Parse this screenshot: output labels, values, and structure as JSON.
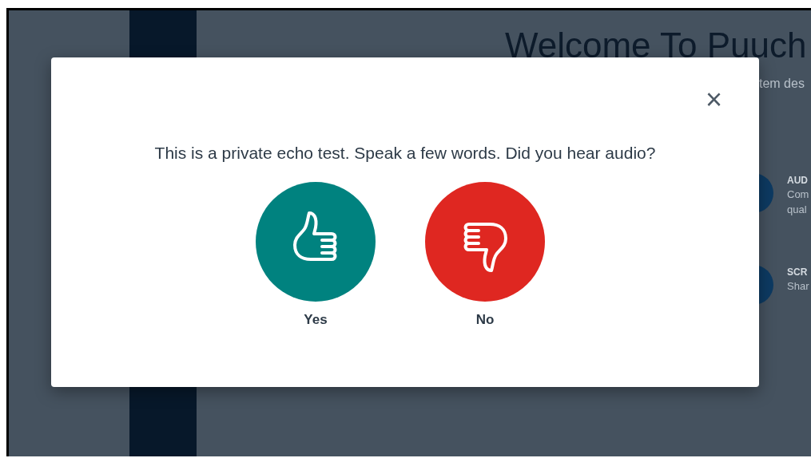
{
  "background": {
    "title": "Welcome To Puuch",
    "subtitle": "tem des",
    "features": [
      {
        "heading": "AUD",
        "lines": [
          "Com",
          "qual"
        ]
      },
      {
        "heading": "SCR",
        "lines": [
          "Shar"
        ]
      }
    ]
  },
  "dialog": {
    "close": "×",
    "question": "This is a private echo test. Speak a few words. Did you hear audio?",
    "answers": [
      {
        "kind": "yes",
        "label": "Yes"
      },
      {
        "kind": "no",
        "label": "No"
      }
    ]
  }
}
